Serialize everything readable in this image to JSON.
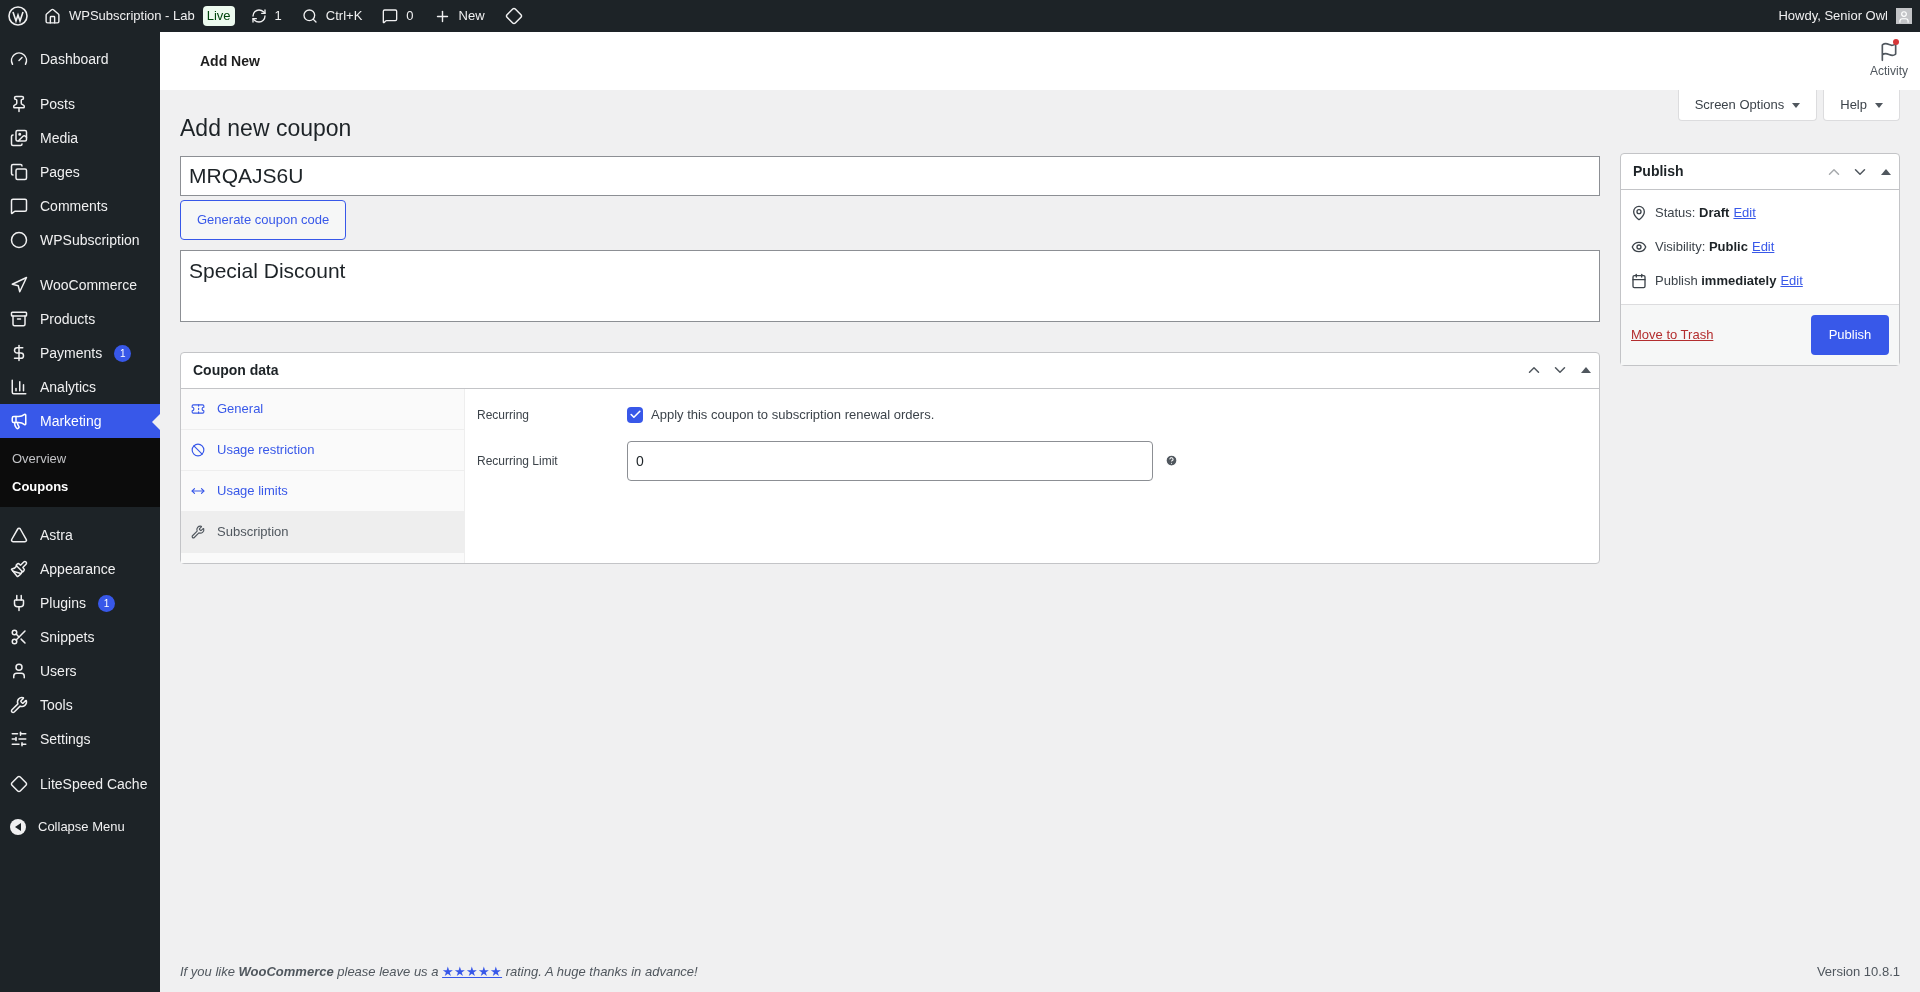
{
  "admin_bar": {
    "site_name": "WPSubscription - Lab",
    "live_badge": "Live",
    "updates_count": "1",
    "search_shortcut": "Ctrl+K",
    "comments_count": "0",
    "new_label": "New",
    "greeting": "Howdy, Senior Owl"
  },
  "sidebar": {
    "sections": [
      [
        {
          "label": "Dashboard",
          "selected": false
        }
      ],
      [
        {
          "label": "Posts",
          "selected": false
        },
        {
          "label": "Media",
          "selected": false
        },
        {
          "label": "Pages",
          "selected": false
        },
        {
          "label": "Comments",
          "selected": false
        },
        {
          "label": "WPSubscription",
          "selected": false
        }
      ],
      [
        {
          "label": "WooCommerce",
          "selected": false
        },
        {
          "label": "Products",
          "selected": false
        },
        {
          "label": "Payments",
          "selected": false,
          "badge": "1"
        },
        {
          "label": "Analytics",
          "selected": false
        },
        {
          "label": "Marketing",
          "selected": true,
          "children": [
            {
              "label": "Overview",
              "selected": false
            },
            {
              "label": "Coupons",
              "selected": true
            }
          ]
        }
      ],
      [
        {
          "label": "Astra",
          "selected": false
        },
        {
          "label": "Appearance",
          "selected": false
        },
        {
          "label": "Plugins",
          "selected": false,
          "badge": "1"
        },
        {
          "label": "Snippets",
          "selected": false
        },
        {
          "label": "Users",
          "selected": false
        },
        {
          "label": "Tools",
          "selected": false
        },
        {
          "label": "Settings",
          "selected": false
        }
      ],
      [
        {
          "label": "LiteSpeed Cache",
          "selected": false
        }
      ]
    ],
    "collapse_label": "Collapse Menu"
  },
  "header": {
    "title": "Add New",
    "activity_label": "Activity"
  },
  "screen_options": "Screen Options",
  "help": "Help",
  "page_title": "Add new coupon",
  "coupon_code": "MRQAJS6U",
  "generate_button": "Generate coupon code",
  "description": "Special Discount",
  "coupon_data": {
    "title": "Coupon data",
    "tabs": [
      {
        "label": "General",
        "selected": false
      },
      {
        "label": "Usage restriction",
        "selected": false
      },
      {
        "label": "Usage limits",
        "selected": false
      },
      {
        "label": "Subscription",
        "selected": true
      }
    ],
    "recurring": {
      "label": "Recurring",
      "checkbox_label": "Apply this coupon to subscription renewal orders.",
      "checked": true
    },
    "recurring_limit": {
      "label": "Recurring Limit",
      "value": "0"
    }
  },
  "publish": {
    "title": "Publish",
    "rows": [
      {
        "text": "Status: **Draft**",
        "link": "Edit"
      },
      {
        "text": "Visibility: **Public**",
        "link": "Edit"
      },
      {
        "text": "Publish **immediately**",
        "link": "Edit"
      }
    ],
    "trash_link": "Move to Trash",
    "publish_button": "Publish"
  },
  "footer": {
    "before": "If you like **WooCommerce** please leave us a",
    "link": "★★★★★",
    "after": "rating. A huge thanks in advance!",
    "version": "Version 10.8.1"
  }
}
